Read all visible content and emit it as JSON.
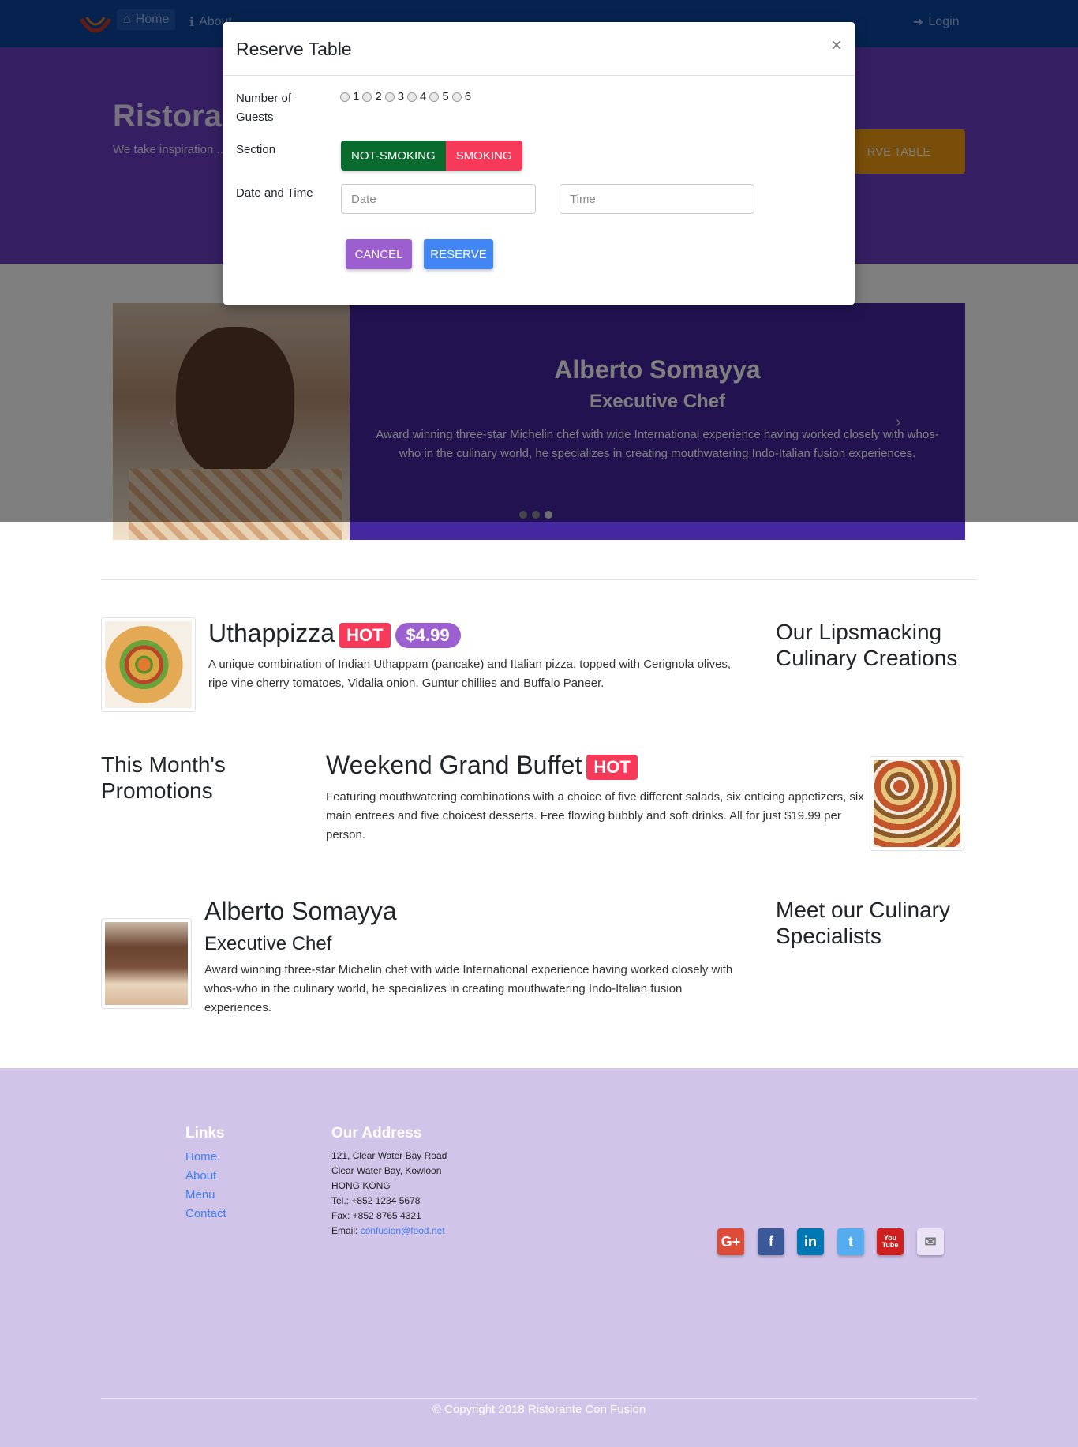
{
  "navbar": {
    "home_label": "Home",
    "about_label": "About",
    "login_label": "Login"
  },
  "jumbotron": {
    "title": "Ristorante",
    "text": "We take inspiration ... fusion experience. ... senses!",
    "reserve_label": "RVE TABLE"
  },
  "carousel": {
    "name": "Alberto Somayya",
    "role": "Executive Chef",
    "description": "Award winning three-star Michelin chef with wide International experience having worked closely with whos-who in the culinary world, he specializes in creating mouthwatering Indo-Italian fusion experiences.",
    "prev": "‹",
    "next": "›"
  },
  "modal": {
    "title": "Reserve Table",
    "close": "×",
    "guests_label": "Number of Guests",
    "guest_options": [
      "1",
      "2",
      "3",
      "4",
      "5",
      "6"
    ],
    "section_label": "Section",
    "section_options": [
      "NOT-SMOKING",
      "SMOKING"
    ],
    "datetime_label": "Date and Time",
    "date_placeholder": "Date",
    "time_placeholder": "Time",
    "cancel_label": "CANCEL",
    "reserve_label": "RESERVE"
  },
  "dish": {
    "name": "Uthappizza",
    "badge": "HOT",
    "price": "$4.99",
    "description": "A unique combination of Indian Uthappam (pancake) and Italian pizza, topped with Cerignola olives, ripe vine cherry tomatoes, Vidalia onion, Guntur chillies and Buffalo Paneer.",
    "side_title": "Our Lipsmacking Culinary Creations"
  },
  "promotion": {
    "side_title": "This Month's Promotions",
    "name": "Weekend Grand Buffet",
    "badge": "HOT",
    "description": "Featuring mouthwatering combinations with a choice of five different salads, six enticing appetizers, six main entrees and five choicest desserts. Free flowing bubbly and soft drinks. All for just $19.99 per person."
  },
  "leader": {
    "name": "Alberto Somayya",
    "role": "Executive Chef",
    "description": "Award winning three-star Michelin chef with wide International experience having worked closely with whos-who in the culinary world, he specializes in creating mouthwatering Indo-Italian fusion experiences.",
    "side_title": "Meet our Culinary Specialists"
  },
  "footer": {
    "links_title": "Links",
    "links": [
      "Home",
      "About",
      "Menu",
      "Contact"
    ],
    "address_title": "Our Address",
    "address_lines": [
      "121, Clear Water Bay Road",
      "Clear Water Bay, Kowloon",
      "HONG KONG",
      "Tel.: +852 1234 5678",
      "Fax: +852 8765 4321"
    ],
    "email_label": "Email: ",
    "email": "confusion@food.net",
    "social": [
      "G+",
      "f",
      "in",
      "t",
      "You Tube",
      "✉"
    ],
    "copyright": "© Copyright 2018 Ristorante Con Fusion"
  },
  "colors": {
    "navbar": "#0d47a1",
    "jumbotron": "#6a3fc4",
    "footer": "#d1c4e9",
    "hot_badge": "#f73a5a",
    "price_badge": "#9c5fd0"
  }
}
